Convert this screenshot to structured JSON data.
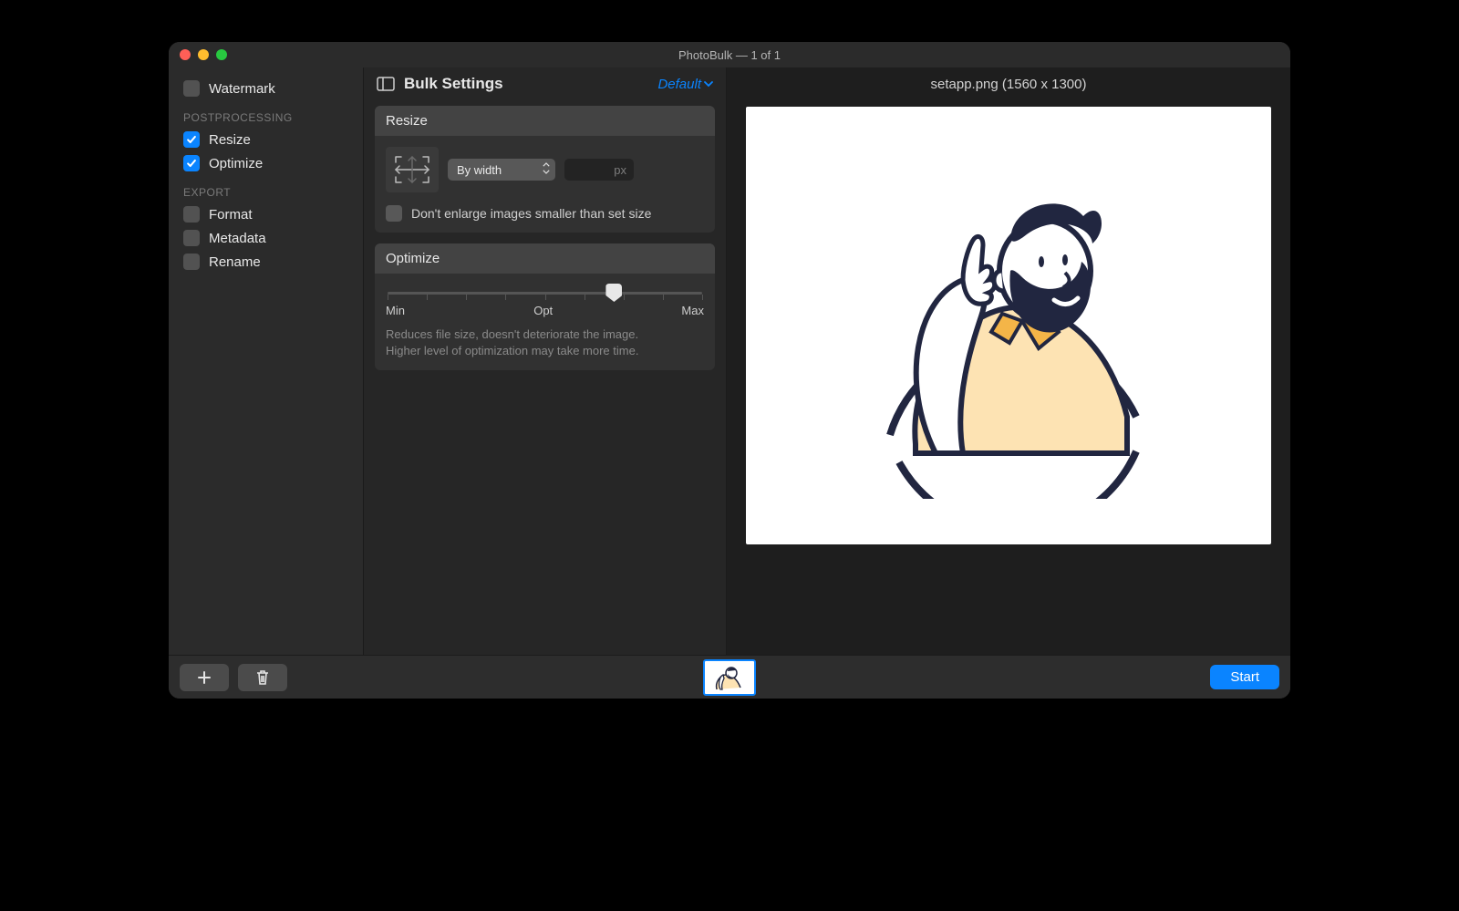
{
  "window": {
    "title": "PhotoBulk — 1 of 1"
  },
  "sidebar": {
    "watermark": "Watermark",
    "postprocessing_heading": "POSTPROCESSING",
    "resize": "Resize",
    "optimize": "Optimize",
    "export_heading": "EXPORT",
    "format": "Format",
    "metadata": "Metadata",
    "rename": "Rename"
  },
  "settings": {
    "title": "Bulk Settings",
    "preset_label": "Default",
    "resize": {
      "title": "Resize",
      "mode": "By width",
      "unit": "px",
      "dont_enlarge": "Don't enlarge images smaller than set size"
    },
    "optimize": {
      "title": "Optimize",
      "min": "Min",
      "opt": "Opt",
      "max": "Max",
      "help1": "Reduces file size, doesn't deteriorate the image.",
      "help2": "Higher level of optimization may take more time."
    }
  },
  "preview": {
    "filename": "setapp.png (1560 x 1300)"
  },
  "footer": {
    "start": "Start"
  }
}
